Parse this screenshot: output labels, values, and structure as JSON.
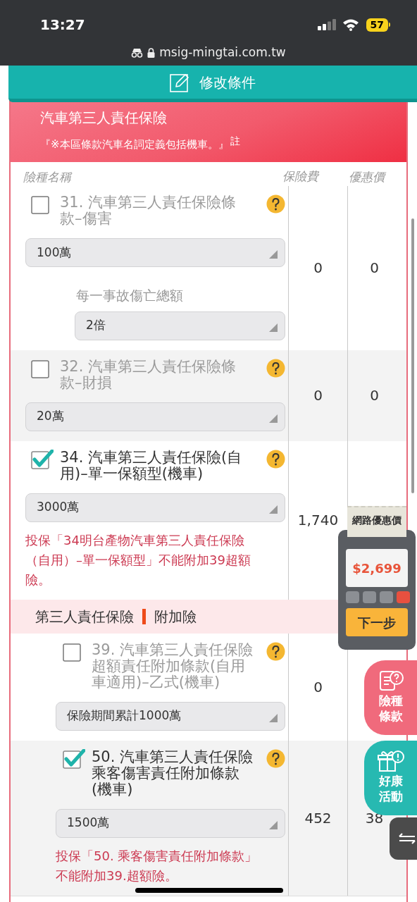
{
  "status_bar": {
    "time": "13:27",
    "battery": "57"
  },
  "browser": {
    "url": "msig-mingtai.com.tw"
  },
  "edit_button": {
    "label": "修改條件"
  },
  "section": {
    "title": "汽車第三人責任保險",
    "note": "『※本區條款汽車名詞定義包括機車。』",
    "note_mark": "註"
  },
  "columns": [
    "險種名稱",
    "保險費",
    "優惠價"
  ],
  "main_items": [
    {
      "checked": false,
      "title": "31. 汽車第三人責任保險條款–傷害",
      "selects": [
        {
          "value": "100萬"
        },
        {
          "label": "每一事故傷亡總額",
          "value": "2倍"
        }
      ],
      "fee": "0",
      "discount": "0"
    },
    {
      "checked": false,
      "title": "32. 汽車第三人責任保險條款–財損",
      "selects": [
        {
          "value": "20萬"
        }
      ],
      "fee": "0",
      "discount": "0"
    },
    {
      "checked": true,
      "title": "34. 汽車第三人責任保險(自用)–單一保額型(機車)",
      "selects": [
        {
          "value": "3000萬"
        }
      ],
      "warning": "投保「34明台產物汽車第三人責任保險（自用）–單一保額型」不能附加39超額險。",
      "fee": "1,740"
    }
  ],
  "rider_section": {
    "title": "第三人責任保險",
    "subtitle": "附加險",
    "items": [
      {
        "checked": false,
        "title": "39. 汽車第三人責任保險超額責任附加條款(自用車適用)–乙式(機車)",
        "selects": [
          {
            "value": "保險期間累計1000萬"
          }
        ],
        "fee": "0"
      },
      {
        "checked": true,
        "title": "50. 汽車第三人責任保險乘客傷害責任附加條款(機車)",
        "selects": [
          {
            "value": "1500萬"
          }
        ],
        "warning": "投保「50. 乘客傷害責任附加條款」不能附加39.超額險。",
        "fee": "452",
        "discount": "38"
      }
    ]
  },
  "calculator": {
    "tag": "網路優惠價",
    "total": "$2,699",
    "next": "下一步"
  },
  "side_buttons": [
    {
      "kind": "terms",
      "label": "險種條款"
    },
    {
      "kind": "promo",
      "label": "好康活動"
    }
  ]
}
